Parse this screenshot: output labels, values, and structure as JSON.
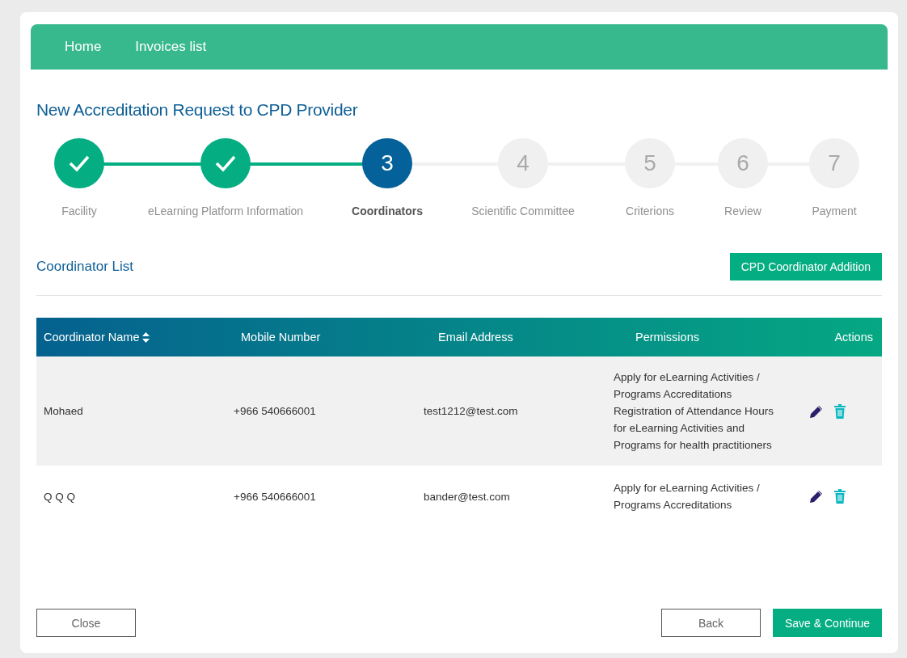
{
  "nav": {
    "links": [
      "Home",
      "Invoices list"
    ]
  },
  "title": "New Accreditation Request to CPD Provider",
  "steps": [
    {
      "label": "Facility",
      "kind": "done"
    },
    {
      "label": "eLearning Platform Information",
      "kind": "done"
    },
    {
      "number": "3",
      "label": "Coordinators",
      "kind": "current"
    },
    {
      "number": "4",
      "label": "Scientific Committee",
      "kind": "pending"
    },
    {
      "number": "5",
      "label": "Criterions",
      "kind": "pending"
    },
    {
      "number": "6",
      "label": "Review",
      "kind": "pending"
    },
    {
      "number": "7",
      "label": "Payment",
      "kind": "pending"
    }
  ],
  "section": {
    "title": "Coordinator List",
    "add_button": "CPD Coordinator Addition"
  },
  "table": {
    "columns": [
      "Coordinator Name",
      "Mobile Number",
      "Email Address",
      "Permissions",
      "Actions"
    ],
    "rows": [
      {
        "name": "Mohaed",
        "mobile": "+966 540666001",
        "email": "test1212@test.com",
        "permissions": [
          "Apply for eLearning Activities / Programs Accreditations",
          "Registration of Attendance Hours for eLearning Activities and Programs for health practitioners"
        ]
      },
      {
        "name": "Q Q Q",
        "mobile": "+966 540666001",
        "email": "bander@test.com",
        "permissions": [
          "Apply for eLearning Activities / Programs Accreditations"
        ]
      }
    ]
  },
  "footer": {
    "close": "Close",
    "back": "Back",
    "save": "Save & Continue"
  }
}
